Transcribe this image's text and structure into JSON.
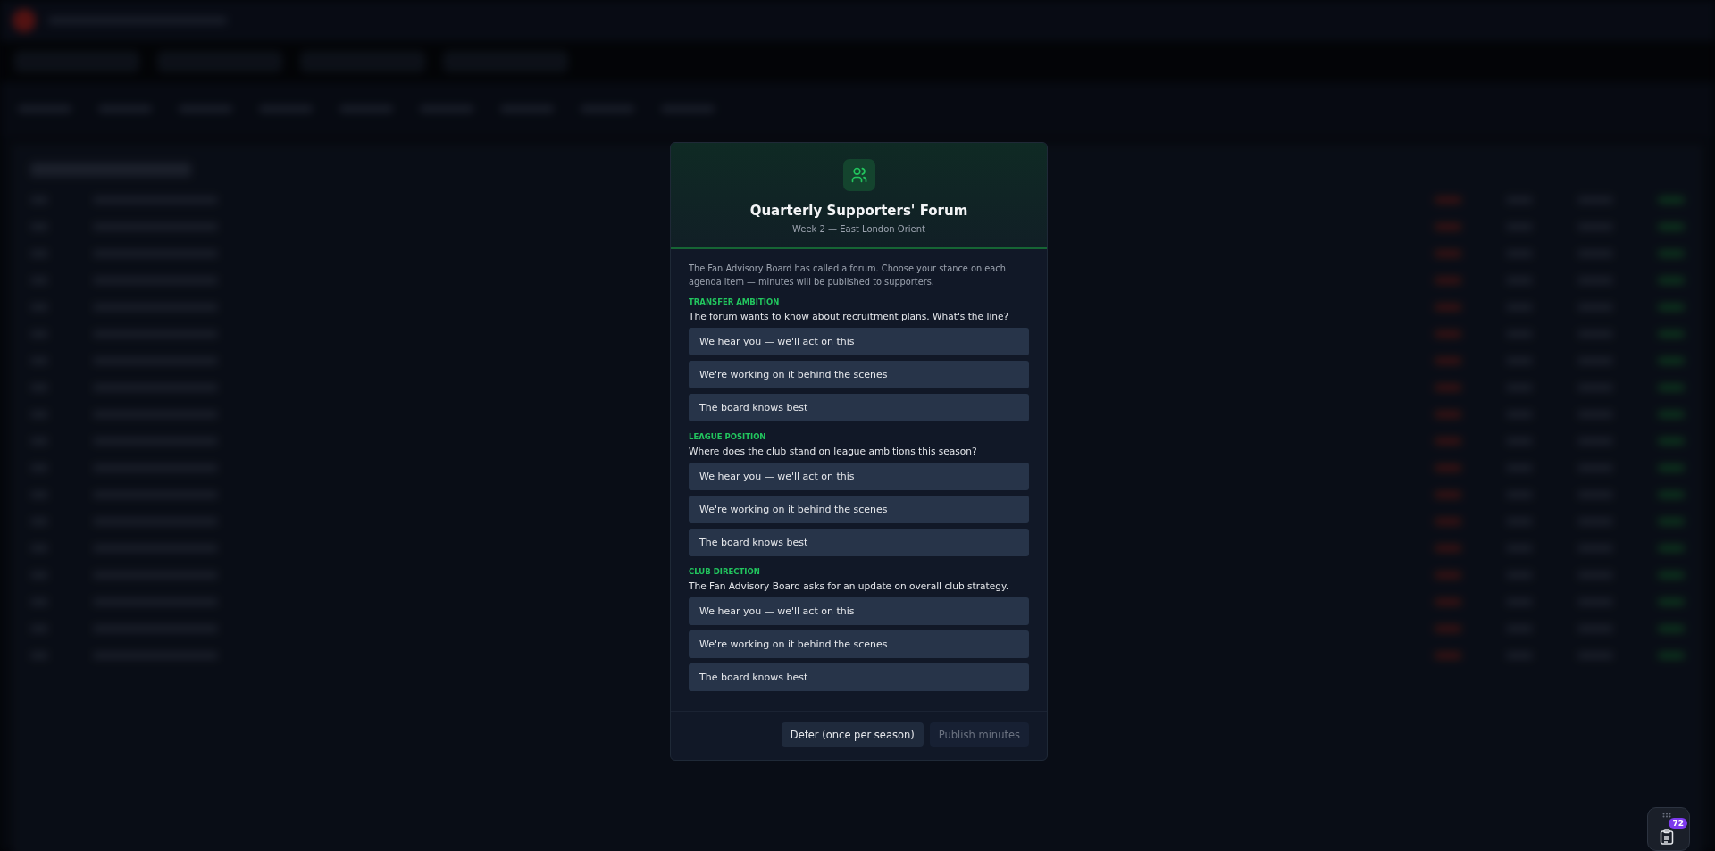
{
  "modal": {
    "title": "Quarterly Supporters' Forum",
    "subtitle": "Week 2 — East London Orient",
    "intro": "The Fan Advisory Board has called a forum. Choose your stance on each agenda item — minutes will be published to supporters.",
    "sections": [
      {
        "label": "TRANSFER AMBITION",
        "question": "The forum wants to know about recruitment plans. What's the line?",
        "options": [
          {
            "label": "We hear you — we'll act on this",
            "selected": false
          },
          {
            "label": "We're working on it behind the scenes",
            "selected": false
          },
          {
            "label": "The board knows best",
            "selected": false
          }
        ]
      },
      {
        "label": "LEAGUE POSITION",
        "question": "Where does the club stand on league ambitions this season?",
        "options": [
          {
            "label": "We hear you — we'll act on this",
            "selected": false
          },
          {
            "label": "We're working on it behind the scenes",
            "selected": false
          },
          {
            "label": "The board knows best",
            "selected": false
          }
        ]
      },
      {
        "label": "CLUB DIRECTION",
        "question": "The Fan Advisory Board asks for an update on overall club strategy.",
        "options": [
          {
            "label": "We hear you — we'll act on this",
            "selected": false
          },
          {
            "label": "We're working on it behind the scenes",
            "selected": false
          },
          {
            "label": "The board knows best",
            "selected": false
          }
        ]
      }
    ],
    "buttons": [
      {
        "label": "Defer (once per season)",
        "disabled": false
      },
      {
        "label": "Publish minutes",
        "disabled": true
      }
    ]
  },
  "task_widget": {
    "badge": "72"
  }
}
